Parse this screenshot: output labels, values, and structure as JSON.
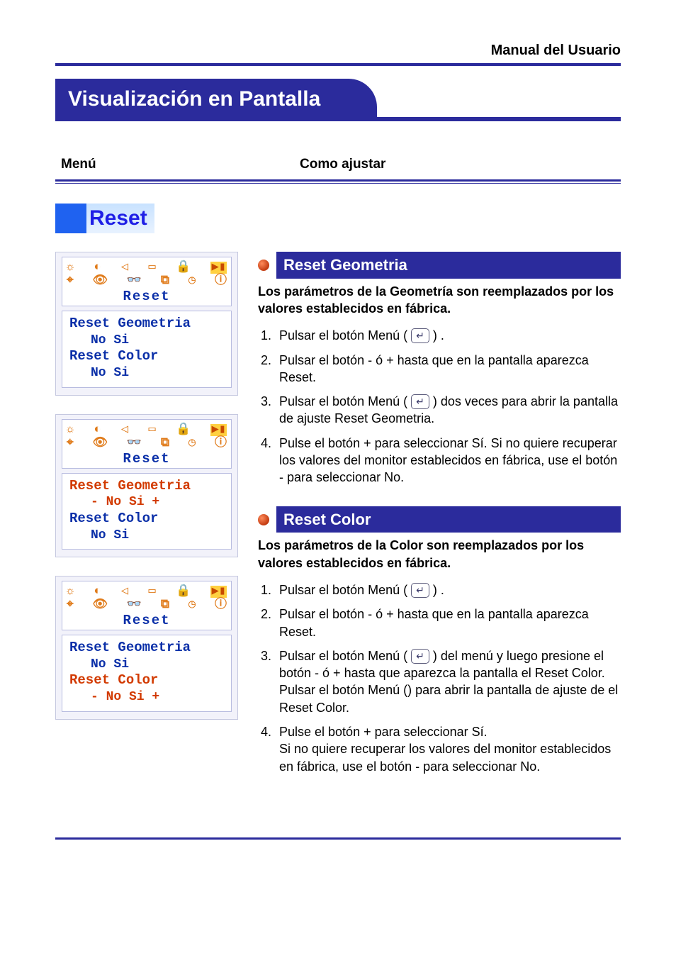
{
  "header": {
    "manual_label": "Manual del Usuario",
    "page_title": "Visualización en Pantalla"
  },
  "columns_header": {
    "left": "Menú",
    "right": "Como ajustar"
  },
  "section_label": "Reset",
  "osd": {
    "bar_title": "Reset",
    "icons_row1": [
      "brightness-icon",
      "contrast-icon",
      "hsize-icon",
      "screen-icon",
      "lock-icon",
      "highlight-icon"
    ],
    "icons_row2": [
      "key-icon",
      "eye-icon",
      "glasses-icon",
      "page-icon",
      "clock-icon",
      "info-icon"
    ],
    "box1": {
      "line1": "Reset Geometria",
      "line1_opts": "No   Si",
      "line2": "Reset Color",
      "line2_opts": "No   Si",
      "active": "none"
    },
    "box2": {
      "line1": "Reset Geometria",
      "line1_opts": "- No   Si +",
      "line2": "Reset Color",
      "line2_opts": "No   Si",
      "active": "line1"
    },
    "box3": {
      "line1": "Reset Geometria",
      "line1_opts": "No   Si",
      "line2": "Reset Color",
      "line2_opts": "- No   Si +",
      "active": "line2"
    }
  },
  "right": {
    "sec1": {
      "title": "Reset Geometria",
      "lead": "Los parámetros de la Geometría son reemplazados por los valores establecidos en fábrica.",
      "steps": [
        {
          "n": "1.",
          "pre": "Pulsar el botón Menú ( ",
          "post": " ) .",
          "btn": true
        },
        {
          "n": "2.",
          "text": "Pulsar el botón - ó + hasta que en la pantalla aparezca Reset."
        },
        {
          "n": "3.",
          "pre": "Pulsar el botón Menú ( ",
          "post": " ) dos veces para abrir la pantalla de ajuste Reset Geometria.",
          "btn": true
        },
        {
          "n": "4.",
          "text": "Pulse el botón + para seleccionar Sí. Si no quiere recuperar los valores del monitor establecidos en fábrica, use el botón - para seleccionar No."
        }
      ]
    },
    "sec2": {
      "title": "Reset Color",
      "lead": "Los parámetros de la Color son reemplazados por los valores establecidos en fábrica.",
      "steps": [
        {
          "n": "1.",
          "pre": "Pulsar el botón Menú ( ",
          "post": " ) .",
          "btn": true
        },
        {
          "n": "2.",
          "text": "Pulsar el botón - ó + hasta que en la pantalla aparezca Reset."
        },
        {
          "n": "3.",
          "pre": "Pulsar el botón Menú ( ",
          "post": " ) del menú y luego presione el botón - ó + hasta que aparezca la pantalla el Reset Color. Pulsar el botón Menú () para abrir la pantalla de ajuste de el Reset Color.",
          "btn": true
        },
        {
          "n": "4.",
          "text": "Pulse el botón + para seleccionar Sí.\nSi no quiere recuperar los valores del monitor establecidos en fábrica, use el botón - para seleccionar No."
        }
      ]
    }
  },
  "glyphs": {
    "icons_row1": [
      "☼",
      "◐",
      "◁",
      "▭",
      "🔒",
      "▶▮"
    ],
    "icons_row2": [
      "⌖",
      "👁",
      "👓",
      "⧉",
      "◷",
      "ⓘ"
    ],
    "menu_btn": "↵"
  }
}
